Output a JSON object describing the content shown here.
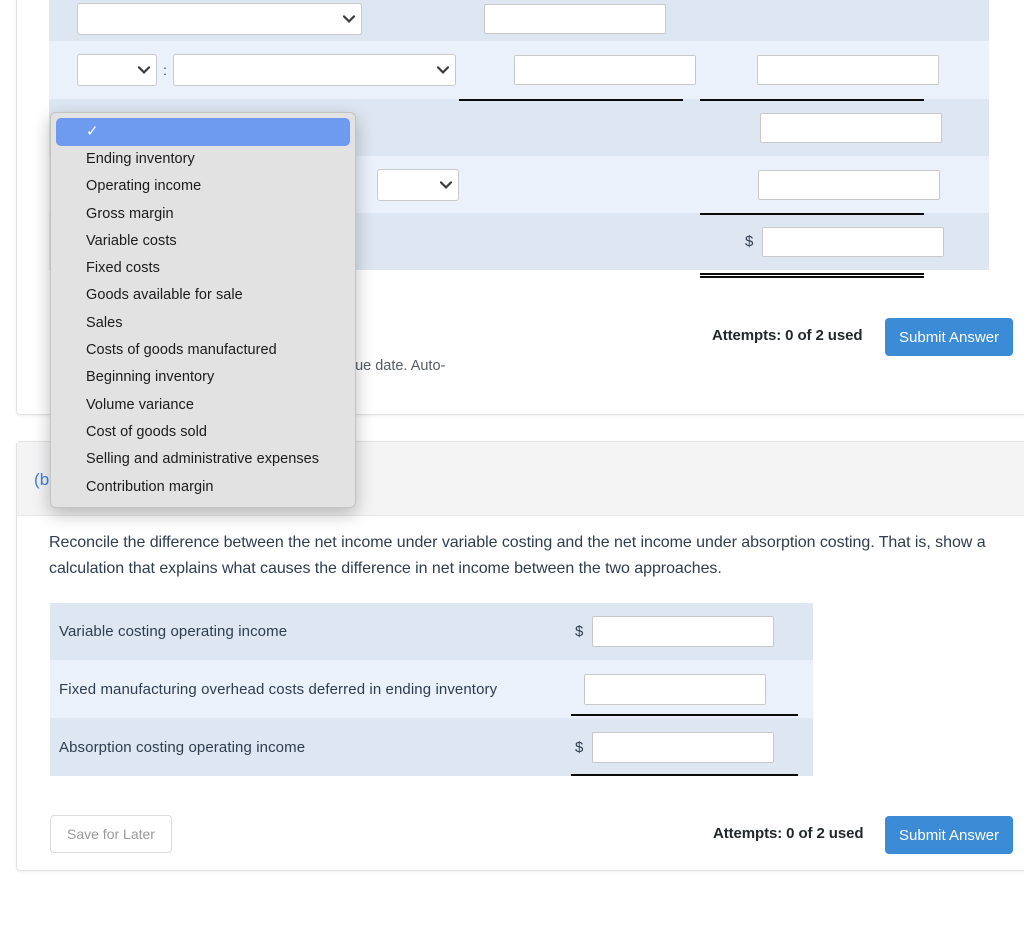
{
  "page": {
    "part_b_label": "(b",
    "prompt": "Reconcile the difference between the net income under variable costing and the net income under absorption costing. That is, show a calculation that explains what causes the difference in net income between the two approaches.",
    "note_partial": "due date. Auto-"
  },
  "dropdown": {
    "name": "account-line-item-select",
    "selected_value": "",
    "selected_check_icon": "check-icon",
    "options": [
      "",
      "Ending inventory",
      "Operating income",
      "Gross margin",
      "Variable costs",
      "Fixed costs",
      "Goods available for sale",
      "Sales",
      "Costs of goods manufactured",
      "Beginning inventory",
      "Volume variance",
      "Cost of goods sold",
      "Selling and administrative expenses",
      "Contribution margin"
    ]
  },
  "top_table": {
    "rows": [
      {
        "kind": "select-wide",
        "value": "",
        "amount1": "",
        "amount2": null
      },
      {
        "kind": "select-pair",
        "value": "",
        "value2": "",
        "separator": ":",
        "amount1": "",
        "amount2": ""
      },
      {
        "kind": "hidden",
        "value": "",
        "amount2": ""
      },
      {
        "kind": "select-mid",
        "value": "",
        "amount2": ""
      },
      {
        "kind": "total",
        "currency": "$",
        "amount2": ""
      }
    ]
  },
  "reconcile_table": {
    "rows": [
      {
        "label": "Variable costing operating income",
        "currency": "$",
        "value": ""
      },
      {
        "label": "Fixed manufacturing overhead costs deferred in ending inventory",
        "currency": "",
        "value": ""
      },
      {
        "label": "Absorption costing operating income",
        "currency": "$",
        "value": ""
      }
    ]
  },
  "footer_top": {
    "attempts": "Attempts: 0 of 2 used",
    "submit_label": "Submit Answer"
  },
  "footer_bottom": {
    "save_label": "Save for Later",
    "attempts": "Attempts: 0 of 2 used",
    "submit_label": "Submit Answer"
  },
  "colors": {
    "accent_blue": "#3b8bd6",
    "link_blue": "#3b82dd",
    "row_dark": "#dde6f1",
    "row_light": "#eaf1fb",
    "popup_highlight": "#6e9bef"
  }
}
